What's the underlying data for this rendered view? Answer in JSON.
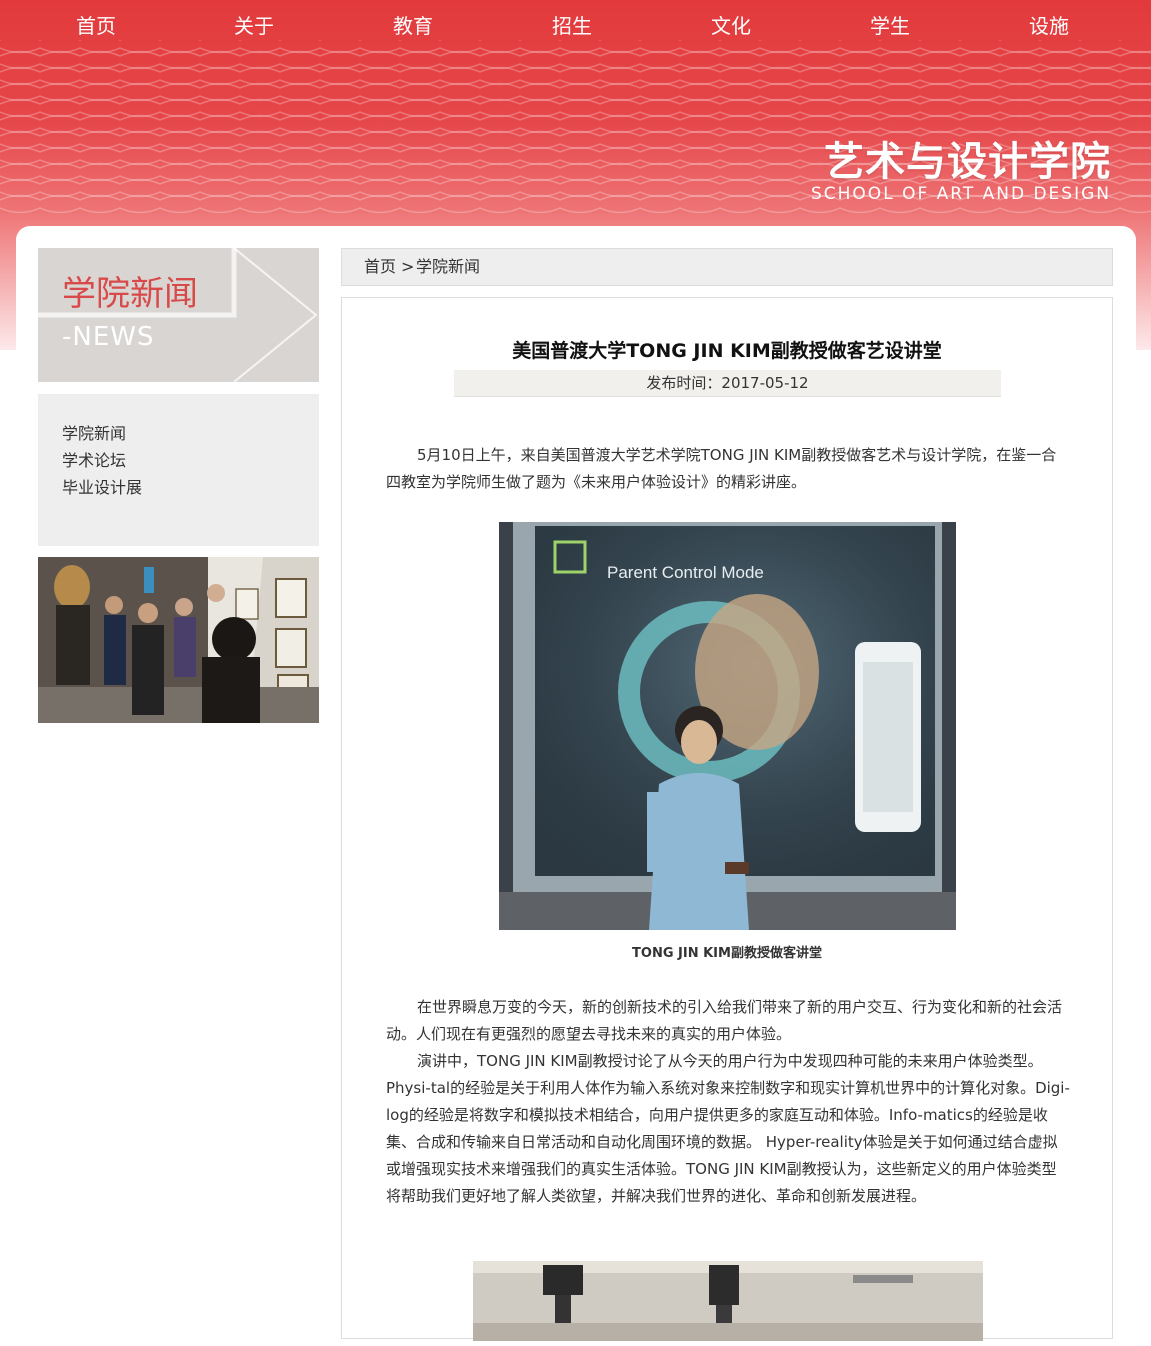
{
  "nav": {
    "items": [
      {
        "label": "首页"
      },
      {
        "label": "关于"
      },
      {
        "label": "教育"
      },
      {
        "label": "招生"
      },
      {
        "label": "文化"
      },
      {
        "label": "学生"
      },
      {
        "label": "设施"
      }
    ]
  },
  "logo": {
    "cn": "艺术与设计学院",
    "en": "SCHOOL OF ART AND DESIGN"
  },
  "sidebar": {
    "banner": {
      "title_cn": "学院新闻",
      "title_en": "-NEWS"
    },
    "menu": [
      {
        "label": "学院新闻"
      },
      {
        "label": "学术论坛"
      },
      {
        "label": "毕业设计展"
      }
    ]
  },
  "breadcrumb": {
    "home": "首页",
    "separator": ">",
    "current": "学院新闻"
  },
  "article": {
    "title": "美国普渡大学TONG JIN KIM副教授做客艺设讲堂",
    "date": "发布时间：2017-05-12",
    "paragraphs": [
      "5月10日上午，来自美国普渡大学艺术学院TONG JIN KIM副教授做客艺术与设计学院，在鉴一合四教室为学院师生做了题为《未来用户体验设计》的精彩讲座。",
      "在世界瞬息万变的今天，新的创新技术的引入给我们带来了新的用户交互、行为变化和新的社会活动。人们现在有更强烈的愿望去寻找未来的真实的用户体验。",
      "演讲中，TONG JIN KIM副教授讨论了从今天的用户行为中发现四种可能的未来用户体验类型。Physi-tal的经验是关于利用人体作为输入系统对象来控制数字和现实计算机世界中的计算化对象。Digi-log的经验是将数字和模拟技术相结合，向用户提供更多的家庭互动和体验。Info-matics的经验是收集、合成和传输来自日常活动和自动化周围环境的数据。 Hyper-reality体验是关于如何通过结合虚拟或增强现实技术来增强我们的真实生活体验。TONG JIN KIM副教授认为，这些新定义的用户体验类型将帮助我们更好地了解人类欲望，并解决我们世界的进化、革命和创新发展进程。"
    ],
    "figure1": {
      "caption": "TONG JIN KIM副教授做客讲堂",
      "screen_text": "Parent Control Mode"
    }
  },
  "colors": {
    "header_red": "#e23a3c",
    "sidebar_title_red": "#d84a4a",
    "panel_gray": "#eeeeee"
  }
}
